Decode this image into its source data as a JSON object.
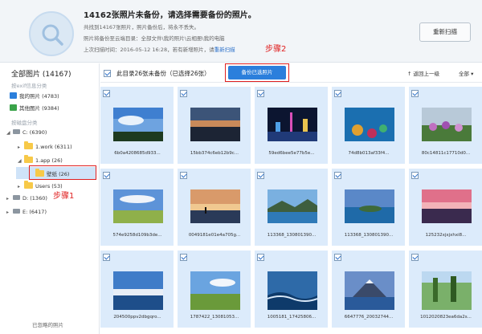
{
  "header": {
    "title": "14162张照片未备份，请选择需要备份的照片。",
    "line1": "共找到14167张照片，照片备份后，将永不丢失。",
    "line2_prefix": "照片将备份至云端目录：",
    "line2_path": "全部文件\\我的照片\\云相册\\我的电脑",
    "line3_prefix": "上次扫描时间：2016-05-12 16:28，若有新增照片，请",
    "line3_link": "重新扫描",
    "rescan_button": "重新扫描"
  },
  "sidebar": {
    "title": "全部图片 (14167)",
    "section_exif": "按exif信息分类",
    "my_photos": "我的照片 (4783)",
    "other_photos": "其他图片 (9384)",
    "section_disk": "按磁盘分类",
    "drive_c": "C: (6390)",
    "folder_work": "1.work (6311)",
    "folder_app": "1.app (26)",
    "folder_wallpaper": "壁纸 (26)",
    "folder_users": "Users (53)",
    "drive_d": "D: (1360)",
    "drive_e": "E: (6417)",
    "step1": "步骤1",
    "footer": "已忽略的照片"
  },
  "toolbar": {
    "select_text": "此目录26张未备份（已选择26张）",
    "backup_button": "备份已选照片",
    "step2": "步骤2",
    "up_level": "返回上一级",
    "all_dropdown": "全部"
  },
  "tiles": [
    {
      "name": "6b0a4208685d933...",
      "scene": "sky"
    },
    {
      "name": "15bb374c6eb12b9c...",
      "scene": "dusk"
    },
    {
      "name": "59ed6bee5e77b5e...",
      "scene": "city"
    },
    {
      "name": "74d8b013af33f4...",
      "scene": "reef"
    },
    {
      "name": "80c14811c17710d0...",
      "scene": "flowers"
    },
    {
      "name": "574e9258d109b3de...",
      "scene": "plain"
    },
    {
      "name": "0049181e01e4a705g...",
      "scene": "bridge"
    },
    {
      "name": "113368_130801390...",
      "scene": "lake"
    },
    {
      "name": "113368_130801390...",
      "scene": "island"
    },
    {
      "name": "125232xjxjxhxi8...",
      "scene": "sunset"
    },
    {
      "name": "204500ppv2dbgqro...",
      "scene": "coast"
    },
    {
      "name": "1787422_13081053...",
      "scene": "meadow"
    },
    {
      "name": "1005181_17425806...",
      "scene": "wave"
    },
    {
      "name": "6647776_20032744...",
      "scene": "volcano"
    },
    {
      "name": "1012020823ea6da2s...",
      "scene": "forest"
    }
  ],
  "colors": {
    "accent": "#2b7fdc",
    "highlight_red": "#e02020",
    "tile_bg": "#dcebfb"
  }
}
